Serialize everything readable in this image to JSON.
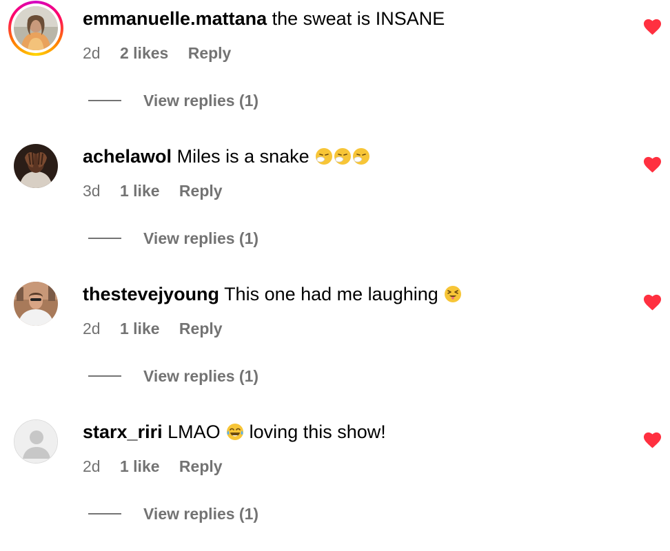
{
  "colors": {
    "text": "#000000",
    "secondary": "#737373",
    "like": "#ff3040",
    "background": "#ffffff"
  },
  "comments": [
    {
      "username": "emmanuelle.mattana",
      "text": "the sweat is INSANE",
      "emoji": "",
      "text_after": "",
      "time": "2d",
      "likes": "2 likes",
      "reply_label": "Reply",
      "view_replies": "View replies (1)",
      "liked": true,
      "avatar_icon": "profile-photo",
      "has_story": true
    },
    {
      "username": "achelawol",
      "text": "Miles is a snake",
      "emoji": "sneezing-face x3",
      "text_after": "",
      "time": "3d",
      "likes": "1 like",
      "reply_label": "Reply",
      "view_replies": "View replies (1)",
      "liked": true,
      "avatar_icon": "profile-photo",
      "has_story": false
    },
    {
      "username": "thestevejyoung",
      "text": "This one had me laughing",
      "emoji": "squinting-face-with-tongue",
      "text_after": "",
      "time": "2d",
      "likes": "1 like",
      "reply_label": "Reply",
      "view_replies": "View replies (1)",
      "liked": true,
      "avatar_icon": "profile-photo",
      "has_story": false
    },
    {
      "username": "starx_riri",
      "text": "LMAO",
      "emoji": "face-with-tears-of-joy",
      "text_after": "loving this show!",
      "time": "2d",
      "likes": "1 like",
      "reply_label": "Reply",
      "view_replies": "View replies (1)",
      "liked": true,
      "avatar_icon": "default-avatar",
      "has_story": false
    }
  ]
}
